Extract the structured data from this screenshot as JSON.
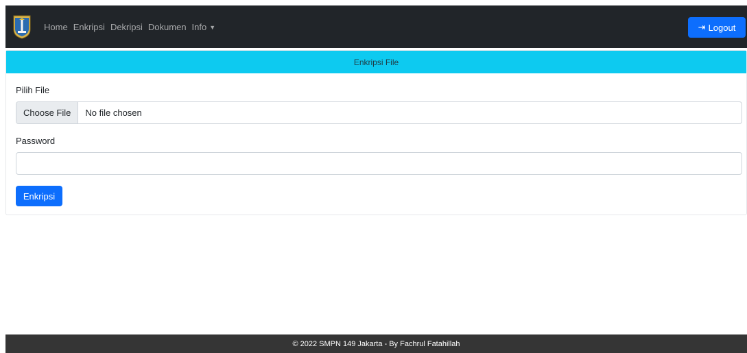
{
  "navbar": {
    "logo_icon": "jakarta-emblem-icon",
    "links": [
      {
        "label": "Home"
      },
      {
        "label": "Enkripsi"
      },
      {
        "label": "Dekripsi"
      },
      {
        "label": "Dokumen"
      },
      {
        "label": "Info"
      }
    ],
    "logout": {
      "label": "Logout",
      "icon": "logout-icon"
    }
  },
  "card": {
    "header": "Enkripsi File",
    "file_label": "Pilih File",
    "file_button": "Choose File",
    "file_status": "No file chosen",
    "password_label": "Password",
    "password_value": "",
    "submit_label": "Enkripsi"
  },
  "footer": {
    "text": "© 2022 SMPN 149 Jakarta - By Fachrul Fatahillah"
  },
  "colors": {
    "navbar_bg": "#212529",
    "primary": "#0d6efd",
    "info": "#0dcaf0",
    "footer_bg": "#353535"
  }
}
